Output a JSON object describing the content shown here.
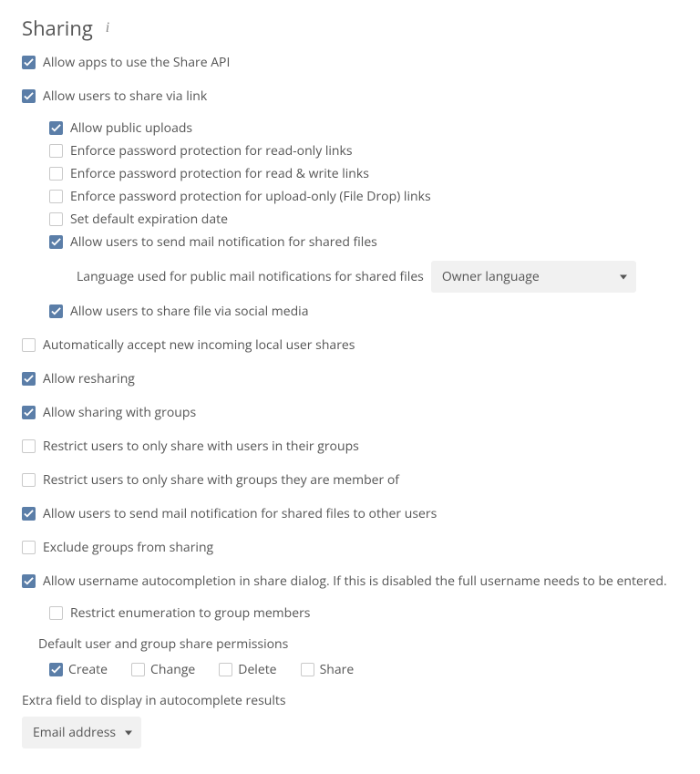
{
  "title": "Sharing",
  "options": {
    "share_api": "Allow apps to use the Share API",
    "share_via_link": "Allow users to share via link",
    "public_uploads": "Allow public uploads",
    "pw_readonly": "Enforce password protection for read-only links",
    "pw_readwrite": "Enforce password protection for read & write links",
    "pw_uploadonly": "Enforce password protection for upload-only (File Drop) links",
    "default_expire": "Set default expiration date",
    "mail_notif": "Allow users to send mail notification for shared files",
    "lang_label": "Language used for public mail notifications for shared files",
    "lang_selected": "Owner language",
    "social_media": "Allow users to share file via social media",
    "auto_accept": "Automatically accept new incoming local user shares",
    "resharing": "Allow resharing",
    "share_groups": "Allow sharing with groups",
    "restrict_users_groups": "Restrict users to only share with users in their groups",
    "restrict_groups_member": "Restrict users to only share with groups they are member of",
    "mail_other_users": "Allow users to send mail notification for shared files to other users",
    "exclude_groups": "Exclude groups from sharing",
    "autocomplete": "Allow username autocompletion in share dialog. If this is disabled the full username needs to be entered.",
    "restrict_enum": "Restrict enumeration to group members",
    "default_perms_label": "Default user and group share permissions",
    "perm_create": "Create",
    "perm_change": "Change",
    "perm_delete": "Delete",
    "perm_share": "Share",
    "extra_field_label": "Extra field to display in autocomplete results",
    "extra_field_selected": "Email address"
  },
  "checked": {
    "share_api": true,
    "share_via_link": true,
    "public_uploads": true,
    "pw_readonly": false,
    "pw_readwrite": false,
    "pw_uploadonly": false,
    "default_expire": false,
    "mail_notif": true,
    "social_media": true,
    "auto_accept": false,
    "resharing": true,
    "share_groups": true,
    "restrict_users_groups": false,
    "restrict_groups_member": false,
    "mail_other_users": true,
    "exclude_groups": false,
    "autocomplete": true,
    "restrict_enum": false,
    "perm_create": true,
    "perm_change": false,
    "perm_delete": false,
    "perm_share": false
  }
}
